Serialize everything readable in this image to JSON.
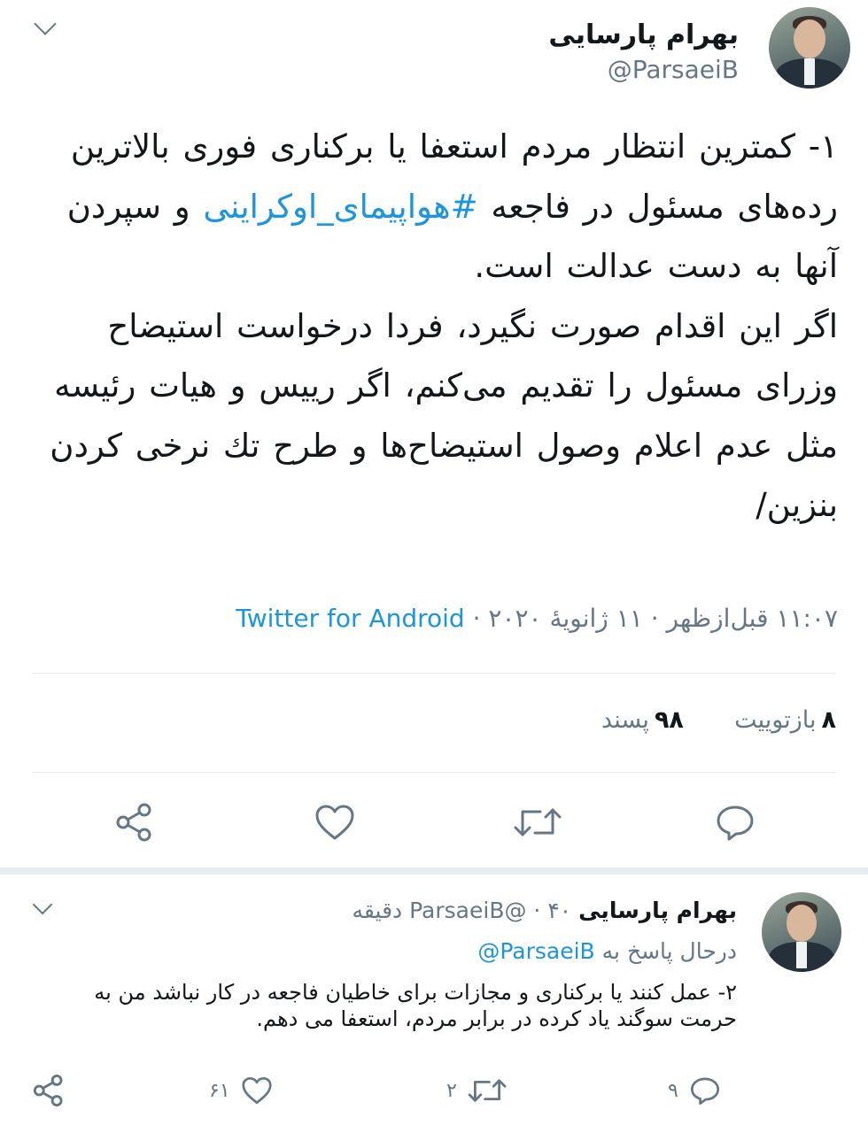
{
  "main_tweet": {
    "author_name": "بهرام پارسایی",
    "author_handle": "@ParsaeiB",
    "text_part1": "۱- کمترین انتظار مردم استعفا یا برکناری فوری بالاترین رده‌های مسئول در فاجعه",
    "hashtag": "#هواپیمای_اوکراینی",
    "text_part2": "و سپردن آنها به دست عدالت است.",
    "text_part3": "اگر این اقدام صورت نگیرد، فردا درخواست استیضاح وزرای مسئول را تقدیم می‌کنم، اگر رییس و هیات رئیسه مثل عدم اعلام وصول استیضاح‌ها و طرح تك نرخی کردن بنزین/",
    "timestamp": "۱۱:۰۷ قبل‌ازظهر · ۱۱ ژانویهٔ ۲۰۲۰ · ",
    "source": "Twitter for Android",
    "retweets_count": "۸",
    "retweets_label": "بازتوییت",
    "likes_count": "۹۸",
    "likes_label": "پسند"
  },
  "reply_tweet": {
    "author_name": "بهرام پارسایی",
    "author_handle": "ParsaeiB@",
    "time_ago": " · ۴۰ دقیقه",
    "replying_label": "درحال پاسخ به ",
    "replying_to": "ParsaeiB@",
    "text": "۲- عمل کنند یا برکناری و مجازات برای خاطیان فاجعه در کار نباشد من به حرمت سوگند یاد کرده در برابر مردم، استعفا می دهم.",
    "reply_count": "۹",
    "retweet_count": "۲",
    "like_count": "۶۱"
  },
  "colors": {
    "link": "#1b95e0",
    "secondary_text": "#657786",
    "divider": "#e6ecf0"
  },
  "icons": [
    "chevron-down-icon",
    "reply-icon",
    "retweet-icon",
    "like-icon",
    "share-icon"
  ]
}
